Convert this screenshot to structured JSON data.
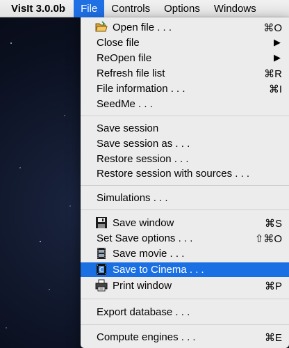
{
  "menubar": {
    "app_name": "VisIt 3.0.0b",
    "items": [
      {
        "label": "File",
        "active": true
      },
      {
        "label": "Controls",
        "active": false
      },
      {
        "label": "Options",
        "active": false
      },
      {
        "label": "Windows",
        "active": false
      }
    ]
  },
  "file_menu": {
    "items": [
      {
        "label": "Open file . . .",
        "shortcut": "⌘O",
        "icon": "folder-open-icon"
      },
      {
        "label": "Close file",
        "submenu": "▶"
      },
      {
        "label": "ReOpen file",
        "submenu": "▶"
      },
      {
        "label": "Refresh file list",
        "shortcut": "⌘R"
      },
      {
        "label": "File information . . .",
        "shortcut": "⌘I"
      },
      {
        "label": "SeedMe . . ."
      },
      {
        "label": "Save session"
      },
      {
        "label": "Save session as . . ."
      },
      {
        "label": "Restore session . . ."
      },
      {
        "label": "Restore session with sources . . ."
      },
      {
        "label": "Simulations . . ."
      },
      {
        "label": "Save window",
        "shortcut": "⌘S",
        "icon": "floppy-disk-icon"
      },
      {
        "label": "Set Save options . . .",
        "shortcut": "⇧⌘O"
      },
      {
        "label": "Save movie . . .",
        "icon": "film-icon"
      },
      {
        "label": "Save to Cinema . . .",
        "icon": "cinema-icon",
        "highlighted": true
      },
      {
        "label": "Print window",
        "shortcut": "⌘P",
        "icon": "printer-icon"
      },
      {
        "label": "Export database . . ."
      },
      {
        "label": "Compute engines . . .",
        "shortcut": "⌘E"
      }
    ]
  },
  "colors": {
    "highlight": "#1a6fe3",
    "menu_bg": "#ececec",
    "active_menubar": "#1f6fe5"
  }
}
